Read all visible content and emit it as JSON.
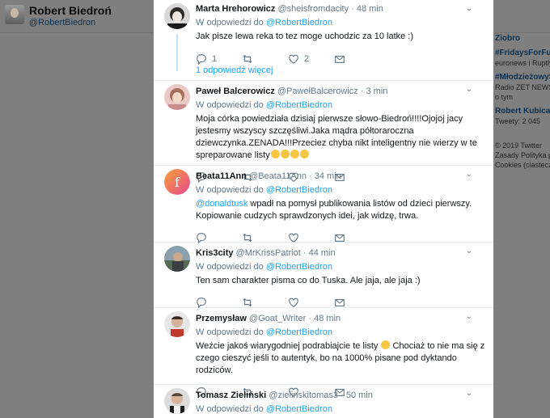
{
  "background": {
    "profile_name": "Robert Biedroń",
    "profile_handle": "@RobertBiedron",
    "sidebar": [
      {
        "title": "Ziobro",
        "sub": ""
      },
      {
        "title": "#FridaysForFutu",
        "sub": "euronews i Ruptly t"
      },
      {
        "title": "#MłodzieżowyS",
        "sub": "Radio ZET NEWS i"
      },
      {
        "title": "Robert Kubica",
        "sub": "Tweety: 2 045"
      }
    ],
    "footer": [
      "© 2019 Twitter",
      "Zasady   Polityka pr",
      "Cookies (ciasteczk"
    ],
    "about": "o tym"
  },
  "modal": {
    "reply_prefix": "W odpowiedzi do",
    "reply_to": "@RobertBiedron",
    "show_more": "1 odpowiedź więcej",
    "tweets": [
      {
        "name": "Marta Hrehorowicz",
        "handle": "@sheisfromdacity",
        "sep": "·",
        "time": "48 min",
        "text": "Jak pisze lewa reka to tez moge uchodzic za 10 latke :)",
        "replies": "1",
        "retweets": "",
        "likes": "2"
      },
      {
        "name": "Paweł Balcerowicz",
        "handle": "@PawełBalcerowicz",
        "sep": "·",
        "time": "3 min",
        "text": "Moja córka powiedziała dzisiaj pierwsze słowo-Biedroń!!!!Ojojoj jacy jestesmy wszyscy szczęśliwi.Jaka mądra półtoraroczna dziewczynka.ZENADA!!!Przeciez chyba nikt inteligentny nie wierzy w te spreparowane listy",
        "replies": "",
        "retweets": "",
        "likes": ""
      },
      {
        "name": "Beata11Ann",
        "handle": "@Beata11Ann",
        "sep": "·",
        "time": "34 min",
        "mention": "@donaldtusk",
        "text": " wpadł na pomysł publikowania listów od dzieci pierwszy. Kopiowanie cudzych sprawdzonych idei, jak widzę, trwa.",
        "replies": "",
        "retweets": "",
        "likes": ""
      },
      {
        "name": "Kris3city",
        "handle": "@MrKrissPatriot",
        "sep": "·",
        "time": "44 min",
        "text": "Ten sam charakter pisma co do Tuska. Ale jaja, ale jaja :)",
        "replies": "",
        "retweets": "",
        "likes": ""
      },
      {
        "name": "Przemysław",
        "handle": "@Goat_Writer",
        "sep": "·",
        "time": "48 min",
        "text": "Weźcie jakoś wiarygodniej podrabiajcie te listy",
        "text2": " Chociaż to nie ma się z czego cieszyć jeśli to autentyk, bo na 1000% pisane pod dyktando rodziców.",
        "replies": "",
        "retweets": "",
        "likes": ""
      },
      {
        "name": "Tomasz Zieliński",
        "handle": "@zielinskitomas3",
        "sep": "·",
        "time": "50 min",
        "text": "",
        "replies": "",
        "retweets": "",
        "likes": ""
      }
    ]
  },
  "colors": {
    "link": "#1da1f2",
    "muted": "#657786",
    "overlay": "#7f7f7f"
  }
}
